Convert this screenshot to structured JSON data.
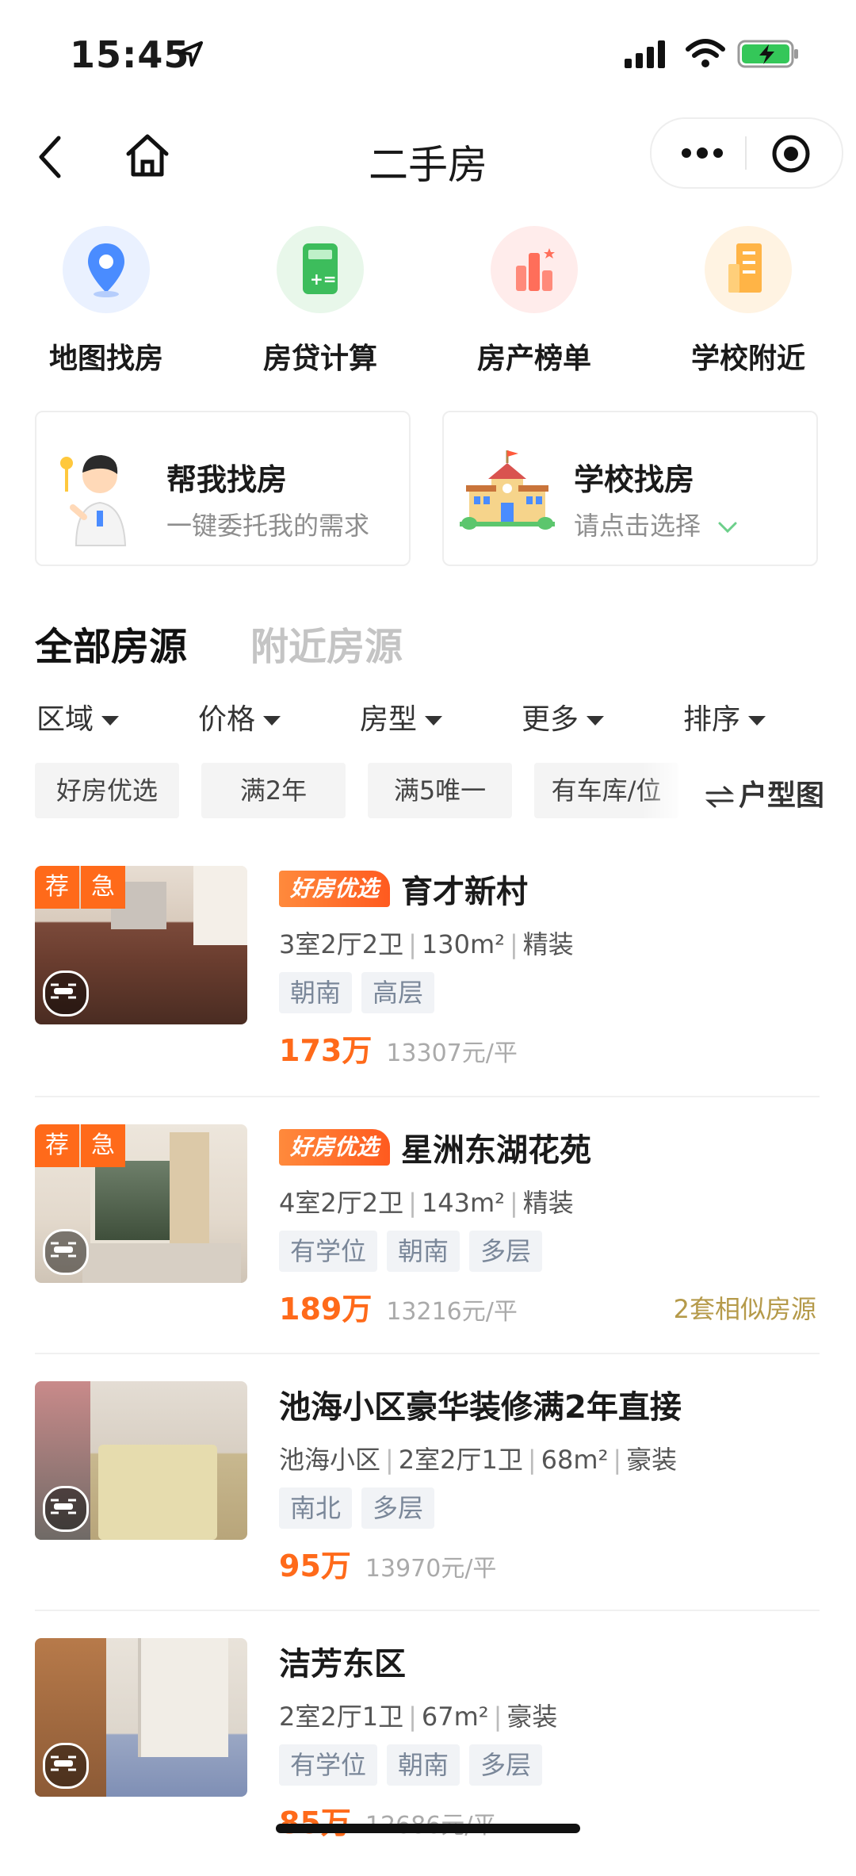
{
  "status_bar": {
    "time": "15:45"
  },
  "nav": {
    "title": "二手房"
  },
  "quick_entries": [
    {
      "label": "地图找房",
      "icon": "map-pin-icon",
      "color": "#4a8cff"
    },
    {
      "label": "房贷计算",
      "icon": "calculator-icon",
      "color": "#3dbd5c"
    },
    {
      "label": "房产榜单",
      "icon": "ranking-icon",
      "color": "#ff6e5a"
    },
    {
      "label": "学校附近",
      "icon": "building-icon",
      "color": "#ffa726"
    }
  ],
  "cards": [
    {
      "title": "帮我找房",
      "subtitle": "一键委托我的需求"
    },
    {
      "title": "学校找房",
      "subtitle": "请点击选择"
    }
  ],
  "tabs": [
    {
      "label": "全部房源",
      "active": true
    },
    {
      "label": "附近房源",
      "active": false
    }
  ],
  "filters": [
    "区域",
    "价格",
    "房型",
    "更多",
    "排序"
  ],
  "chips": [
    "好房优选",
    "满2年",
    "满5唯一",
    "有车库/位"
  ],
  "layout_link": "户型图",
  "listings": [
    {
      "title": "育才新村",
      "good": "好房优选",
      "badges": [
        "荐",
        "急"
      ],
      "meta": [
        "3室2厅2卫",
        "130m²",
        "精装"
      ],
      "tags": [
        "朝南",
        "高层"
      ],
      "price": "173万",
      "unit_price": "13307元/平",
      "similar": ""
    },
    {
      "title": "星洲东湖花苑",
      "good": "好房优选",
      "badges": [
        "荐",
        "急"
      ],
      "meta": [
        "4室2厅2卫",
        "143m²",
        "精装"
      ],
      "tags": [
        "有学位",
        "朝南",
        "多层"
      ],
      "price": "189万",
      "unit_price": "13216元/平",
      "similar": "2套相似房源"
    },
    {
      "title": "池海小区豪华装修满2年直接",
      "good": "",
      "badges": [],
      "meta": [
        "池海小区",
        "2室2厅1卫",
        "68m²",
        "豪装"
      ],
      "tags": [
        "南北",
        "多层"
      ],
      "price": "95万",
      "unit_price": "13970元/平",
      "similar": ""
    },
    {
      "title": "洁芳东区",
      "good": "",
      "badges": [],
      "meta": [
        "2室2厅1卫",
        "67m²",
        "豪装"
      ],
      "tags": [
        "有学位",
        "朝南",
        "多层"
      ],
      "price": "85万",
      "unit_price": "12686元/平",
      "similar": ""
    }
  ]
}
